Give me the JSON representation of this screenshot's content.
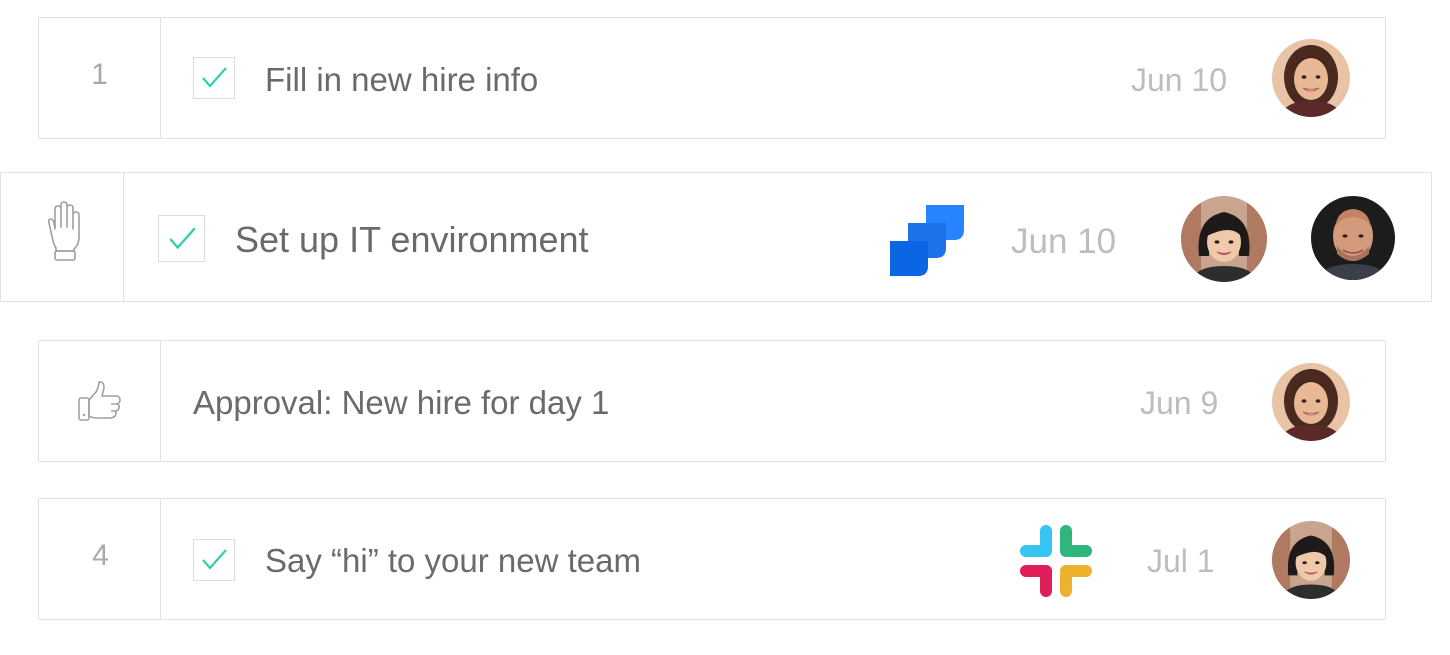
{
  "tasks": [
    {
      "index": "1",
      "title": "Fill in new hire info",
      "date": "Jun 10",
      "checked": true,
      "lead_icon": null,
      "app_icon": null,
      "assignees": [
        "avatar-woman-curly"
      ]
    },
    {
      "index": "",
      "title": "Set up IT environment",
      "date": "Jun 10",
      "checked": true,
      "lead_icon": "hand-drag-icon",
      "app_icon": "jira-icon",
      "assignees": [
        "avatar-woman-bob",
        "avatar-man-bald"
      ]
    },
    {
      "index": "",
      "title": "Approval: New hire for day 1",
      "date": "Jun 9",
      "checked": false,
      "lead_icon": "thumbs-up-icon",
      "app_icon": null,
      "assignees": [
        "avatar-woman-curly"
      ]
    },
    {
      "index": "4",
      "title": "Say “hi” to your new team",
      "date": "Jul 1",
      "checked": true,
      "lead_icon": null,
      "app_icon": "slack-icon",
      "assignees": [
        "avatar-woman-bob"
      ]
    }
  ],
  "colors": {
    "check": "#2ecfae",
    "jira": "#2684ff",
    "slack": [
      "#36c5f0",
      "#2eb67d",
      "#ecb22e",
      "#e01e5a"
    ]
  }
}
